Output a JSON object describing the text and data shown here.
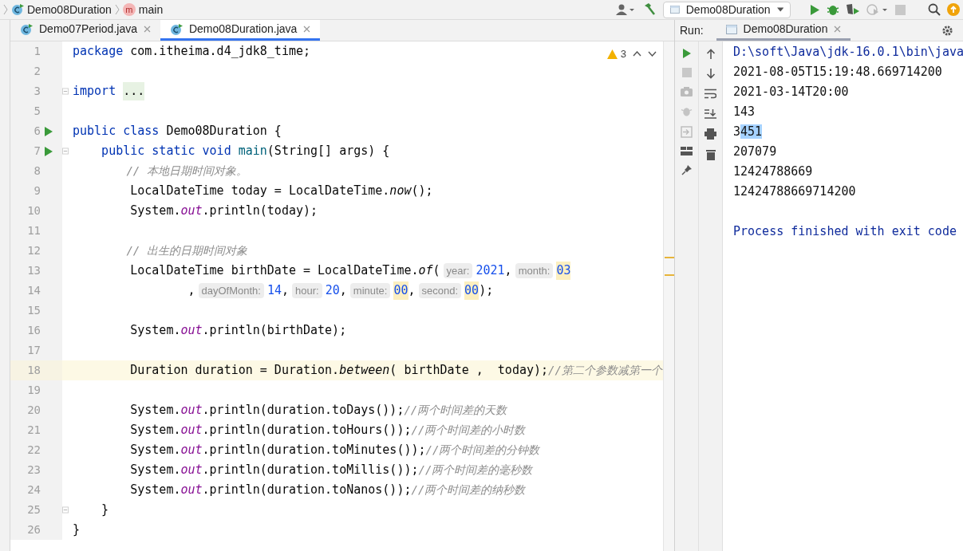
{
  "breadcrumb": [
    {
      "kind": "class",
      "label": "Demo08Duration"
    },
    {
      "kind": "method",
      "icon_letter": "m",
      "label": "main"
    }
  ],
  "toolbar": {
    "run_config": "Demo08Duration"
  },
  "editor_tabs": [
    {
      "label": "Demo07Period.java",
      "selected": false
    },
    {
      "label": "Demo08Duration.java",
      "selected": true
    }
  ],
  "editor": {
    "warnings": "3",
    "lines": [
      {
        "number": "1",
        "run": false,
        "fold": false,
        "current": false,
        "tokens": [
          {
            "kind": "kw",
            "text": "package"
          },
          {
            "kind": "plain",
            "text": " com.itheima.d4_jdk8_time;"
          }
        ]
      },
      {
        "number": "2",
        "run": false,
        "fold": false,
        "current": false
      },
      {
        "number": "3",
        "run": false,
        "fold": true,
        "current": false,
        "tokens": [
          {
            "kind": "kw",
            "text": "import"
          },
          {
            "kind": "folded",
            "text": "..."
          }
        ]
      },
      {
        "number": "5",
        "run": false,
        "fold": false,
        "current": false
      },
      {
        "number": "6",
        "run": true,
        "fold": false,
        "current": false,
        "tokens": [
          {
            "kind": "kw",
            "text": "public class"
          },
          {
            "kind": "plain",
            "text": " Demo08Duration {"
          }
        ]
      },
      {
        "number": "7",
        "run": true,
        "fold": true,
        "current": false,
        "tokens": [
          {
            "kind": "kw",
            "text": "    public static void "
          },
          {
            "kind": "method",
            "text": "main"
          },
          {
            "kind": "plain",
            "text": "(String[] args) {"
          }
        ]
      },
      {
        "number": "8",
        "run": false,
        "fold": false,
        "current": false,
        "tokens": [
          {
            "kind": "comment",
            "text": "        // 本地日期时间对象。"
          }
        ]
      },
      {
        "number": "9",
        "run": false,
        "fold": false,
        "current": false,
        "tokens": [
          {
            "kind": "plain",
            "text": "        LocalDateTime today = LocalDateTime."
          },
          {
            "kind": "static",
            "text": "now"
          },
          {
            "kind": "plain",
            "text": "();"
          }
        ]
      },
      {
        "number": "10",
        "run": false,
        "fold": false,
        "current": false,
        "tokens": [
          {
            "kind": "plain",
            "text": "        System."
          },
          {
            "kind": "field",
            "text": "out"
          },
          {
            "kind": "plain",
            "text": ".println(today);"
          }
        ]
      },
      {
        "number": "11",
        "run": false,
        "fold": false,
        "current": false
      },
      {
        "number": "12",
        "run": false,
        "fold": false,
        "current": false,
        "tokens": [
          {
            "kind": "comment",
            "text": "        // 出生的日期时间对象"
          }
        ]
      },
      {
        "number": "13",
        "run": false,
        "fold": false,
        "current": false,
        "tokens": [
          {
            "kind": "plain",
            "text": "        LocalDateTime birthDate = LocalDateTime."
          },
          {
            "kind": "static",
            "text": "of"
          },
          {
            "kind": "plain",
            "text": "("
          },
          {
            "kind": "hint",
            "text": "year:"
          },
          {
            "kind": "num",
            "text": "2021"
          },
          {
            "kind": "plain",
            "text": ","
          },
          {
            "kind": "hint",
            "text": "month:"
          },
          {
            "kind": "numhl",
            "text": "03"
          }
        ]
      },
      {
        "number": "14",
        "run": false,
        "fold": false,
        "current": false,
        "tokens": [
          {
            "kind": "plain",
            "text": "                ,"
          },
          {
            "kind": "hint",
            "text": "dayOfMonth:"
          },
          {
            "kind": "num",
            "text": "14"
          },
          {
            "kind": "plain",
            "text": ","
          },
          {
            "kind": "hint",
            "text": "hour:"
          },
          {
            "kind": "num",
            "text": "20"
          },
          {
            "kind": "plain",
            "text": ","
          },
          {
            "kind": "hint",
            "text": "minute:"
          },
          {
            "kind": "numhl",
            "text": "00"
          },
          {
            "kind": "plain",
            "text": ","
          },
          {
            "kind": "hint",
            "text": "second:"
          },
          {
            "kind": "numhl",
            "text": "00"
          },
          {
            "kind": "plain",
            "text": ");"
          }
        ]
      },
      {
        "number": "15",
        "run": false,
        "fold": false,
        "current": false
      },
      {
        "number": "16",
        "run": false,
        "fold": false,
        "current": false,
        "tokens": [
          {
            "kind": "plain",
            "text": "        System."
          },
          {
            "kind": "field",
            "text": "out"
          },
          {
            "kind": "plain",
            "text": ".println(birthDate);"
          }
        ]
      },
      {
        "number": "17",
        "run": false,
        "fold": false,
        "current": false
      },
      {
        "number": "18",
        "run": false,
        "fold": false,
        "current": true,
        "tokens": [
          {
            "kind": "plain",
            "text": "        Duration duration = Duration."
          },
          {
            "kind": "static",
            "text": "between"
          },
          {
            "kind": "plain",
            "text": "( birthDate ,  today);"
          },
          {
            "kind": "comment",
            "text": "//第二个参数减第一个"
          }
        ]
      },
      {
        "number": "19",
        "run": false,
        "fold": false,
        "current": false
      },
      {
        "number": "20",
        "run": false,
        "fold": false,
        "current": false,
        "tokens": [
          {
            "kind": "plain",
            "text": "        System."
          },
          {
            "kind": "field",
            "text": "out"
          },
          {
            "kind": "plain",
            "text": ".println(duration.toDays());"
          },
          {
            "kind": "comment",
            "text": "//两个时间差的天数"
          }
        ]
      },
      {
        "number": "21",
        "run": false,
        "fold": false,
        "current": false,
        "tokens": [
          {
            "kind": "plain",
            "text": "        System."
          },
          {
            "kind": "field",
            "text": "out"
          },
          {
            "kind": "plain",
            "text": ".println(duration.toHours());"
          },
          {
            "kind": "comment",
            "text": "//两个时间差的小时数"
          }
        ]
      },
      {
        "number": "22",
        "run": false,
        "fold": false,
        "current": false,
        "tokens": [
          {
            "kind": "plain",
            "text": "        System."
          },
          {
            "kind": "field",
            "text": "out"
          },
          {
            "kind": "plain",
            "text": ".println(duration.toMinutes());"
          },
          {
            "kind": "comment",
            "text": "//两个时间差的分钟数"
          }
        ]
      },
      {
        "number": "23",
        "run": false,
        "fold": false,
        "current": false,
        "tokens": [
          {
            "kind": "plain",
            "text": "        System."
          },
          {
            "kind": "field",
            "text": "out"
          },
          {
            "kind": "plain",
            "text": ".println(duration.toMillis());"
          },
          {
            "kind": "comment",
            "text": "//两个时间差的毫秒数"
          }
        ]
      },
      {
        "number": "24",
        "run": false,
        "fold": false,
        "current": false,
        "tokens": [
          {
            "kind": "plain",
            "text": "        System."
          },
          {
            "kind": "field",
            "text": "out"
          },
          {
            "kind": "plain",
            "text": ".println(duration.toNanos());"
          },
          {
            "kind": "comment",
            "text": "//两个时间差的纳秒数"
          }
        ]
      },
      {
        "number": "25",
        "run": false,
        "fold": true,
        "current": false,
        "tokens": [
          {
            "kind": "plain",
            "text": "    }"
          }
        ]
      },
      {
        "number": "26",
        "run": false,
        "fold": false,
        "current": false,
        "tokens": [
          {
            "kind": "plain",
            "text": "}"
          }
        ]
      }
    ]
  },
  "run_panel": {
    "label": "Run:",
    "tab": "Demo08Duration",
    "output": [
      {
        "kind": "command",
        "parts": [
          {
            "text": "D:\\soft\\Java\\jdk-16.0.1\\bin\\java",
            "selected": false
          }
        ]
      },
      {
        "kind": "normal",
        "parts": [
          {
            "text": "2021-08-05T15:19:48.669714200",
            "selected": false
          }
        ]
      },
      {
        "kind": "normal",
        "parts": [
          {
            "text": "2021-03-14T20:00",
            "selected": false
          }
        ]
      },
      {
        "kind": "normal",
        "parts": [
          {
            "text": "143",
            "selected": false
          }
        ]
      },
      {
        "kind": "normal",
        "parts": [
          {
            "text": "3",
            "selected": false
          },
          {
            "text": "451",
            "selected": true
          }
        ]
      },
      {
        "kind": "normal",
        "parts": [
          {
            "text": "207079",
            "selected": false
          }
        ]
      },
      {
        "kind": "normal",
        "parts": [
          {
            "text": "12424788669",
            "selected": false
          }
        ]
      },
      {
        "kind": "normal",
        "parts": [
          {
            "text": "12424788669714200",
            "selected": false
          }
        ]
      },
      {
        "kind": "blank"
      },
      {
        "kind": "exit",
        "parts": [
          {
            "text": "Process finished with exit code",
            "selected": false
          }
        ]
      }
    ]
  }
}
